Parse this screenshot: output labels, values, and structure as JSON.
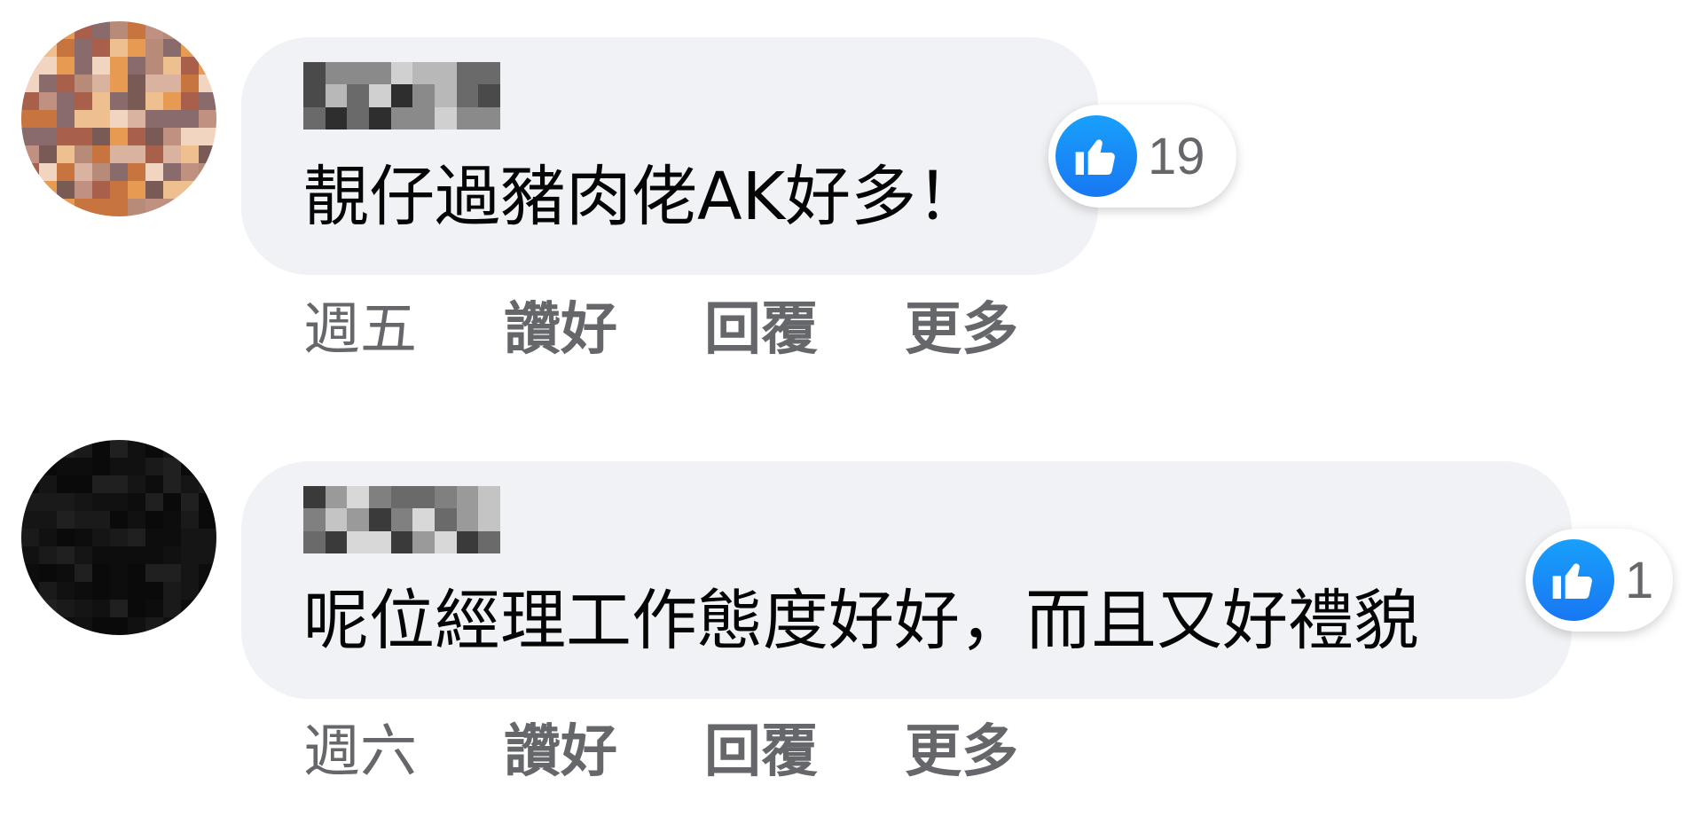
{
  "comments": [
    {
      "text": "靚仔過豬肉佬AK好多！",
      "like_count": "19",
      "time": "週五",
      "actions": {
        "like": "讚好",
        "reply": "回覆",
        "more": "更多"
      },
      "avatar_icon": "pixelated-avatar-orange",
      "reaction_icon": "thumbs-up-icon"
    },
    {
      "text": "呢位經理工作態度好好，而且又好禮貌",
      "like_count": "1",
      "time": "週六",
      "actions": {
        "like": "讚好",
        "reply": "回覆",
        "more": "更多"
      },
      "avatar_icon": "pixelated-avatar-black",
      "reaction_icon": "thumbs-up-icon"
    }
  ],
  "colors": {
    "bubble_bg": "#f0f2f5",
    "text": "#050505",
    "secondary_text": "#65676b",
    "like_blue": "#1877f2"
  }
}
